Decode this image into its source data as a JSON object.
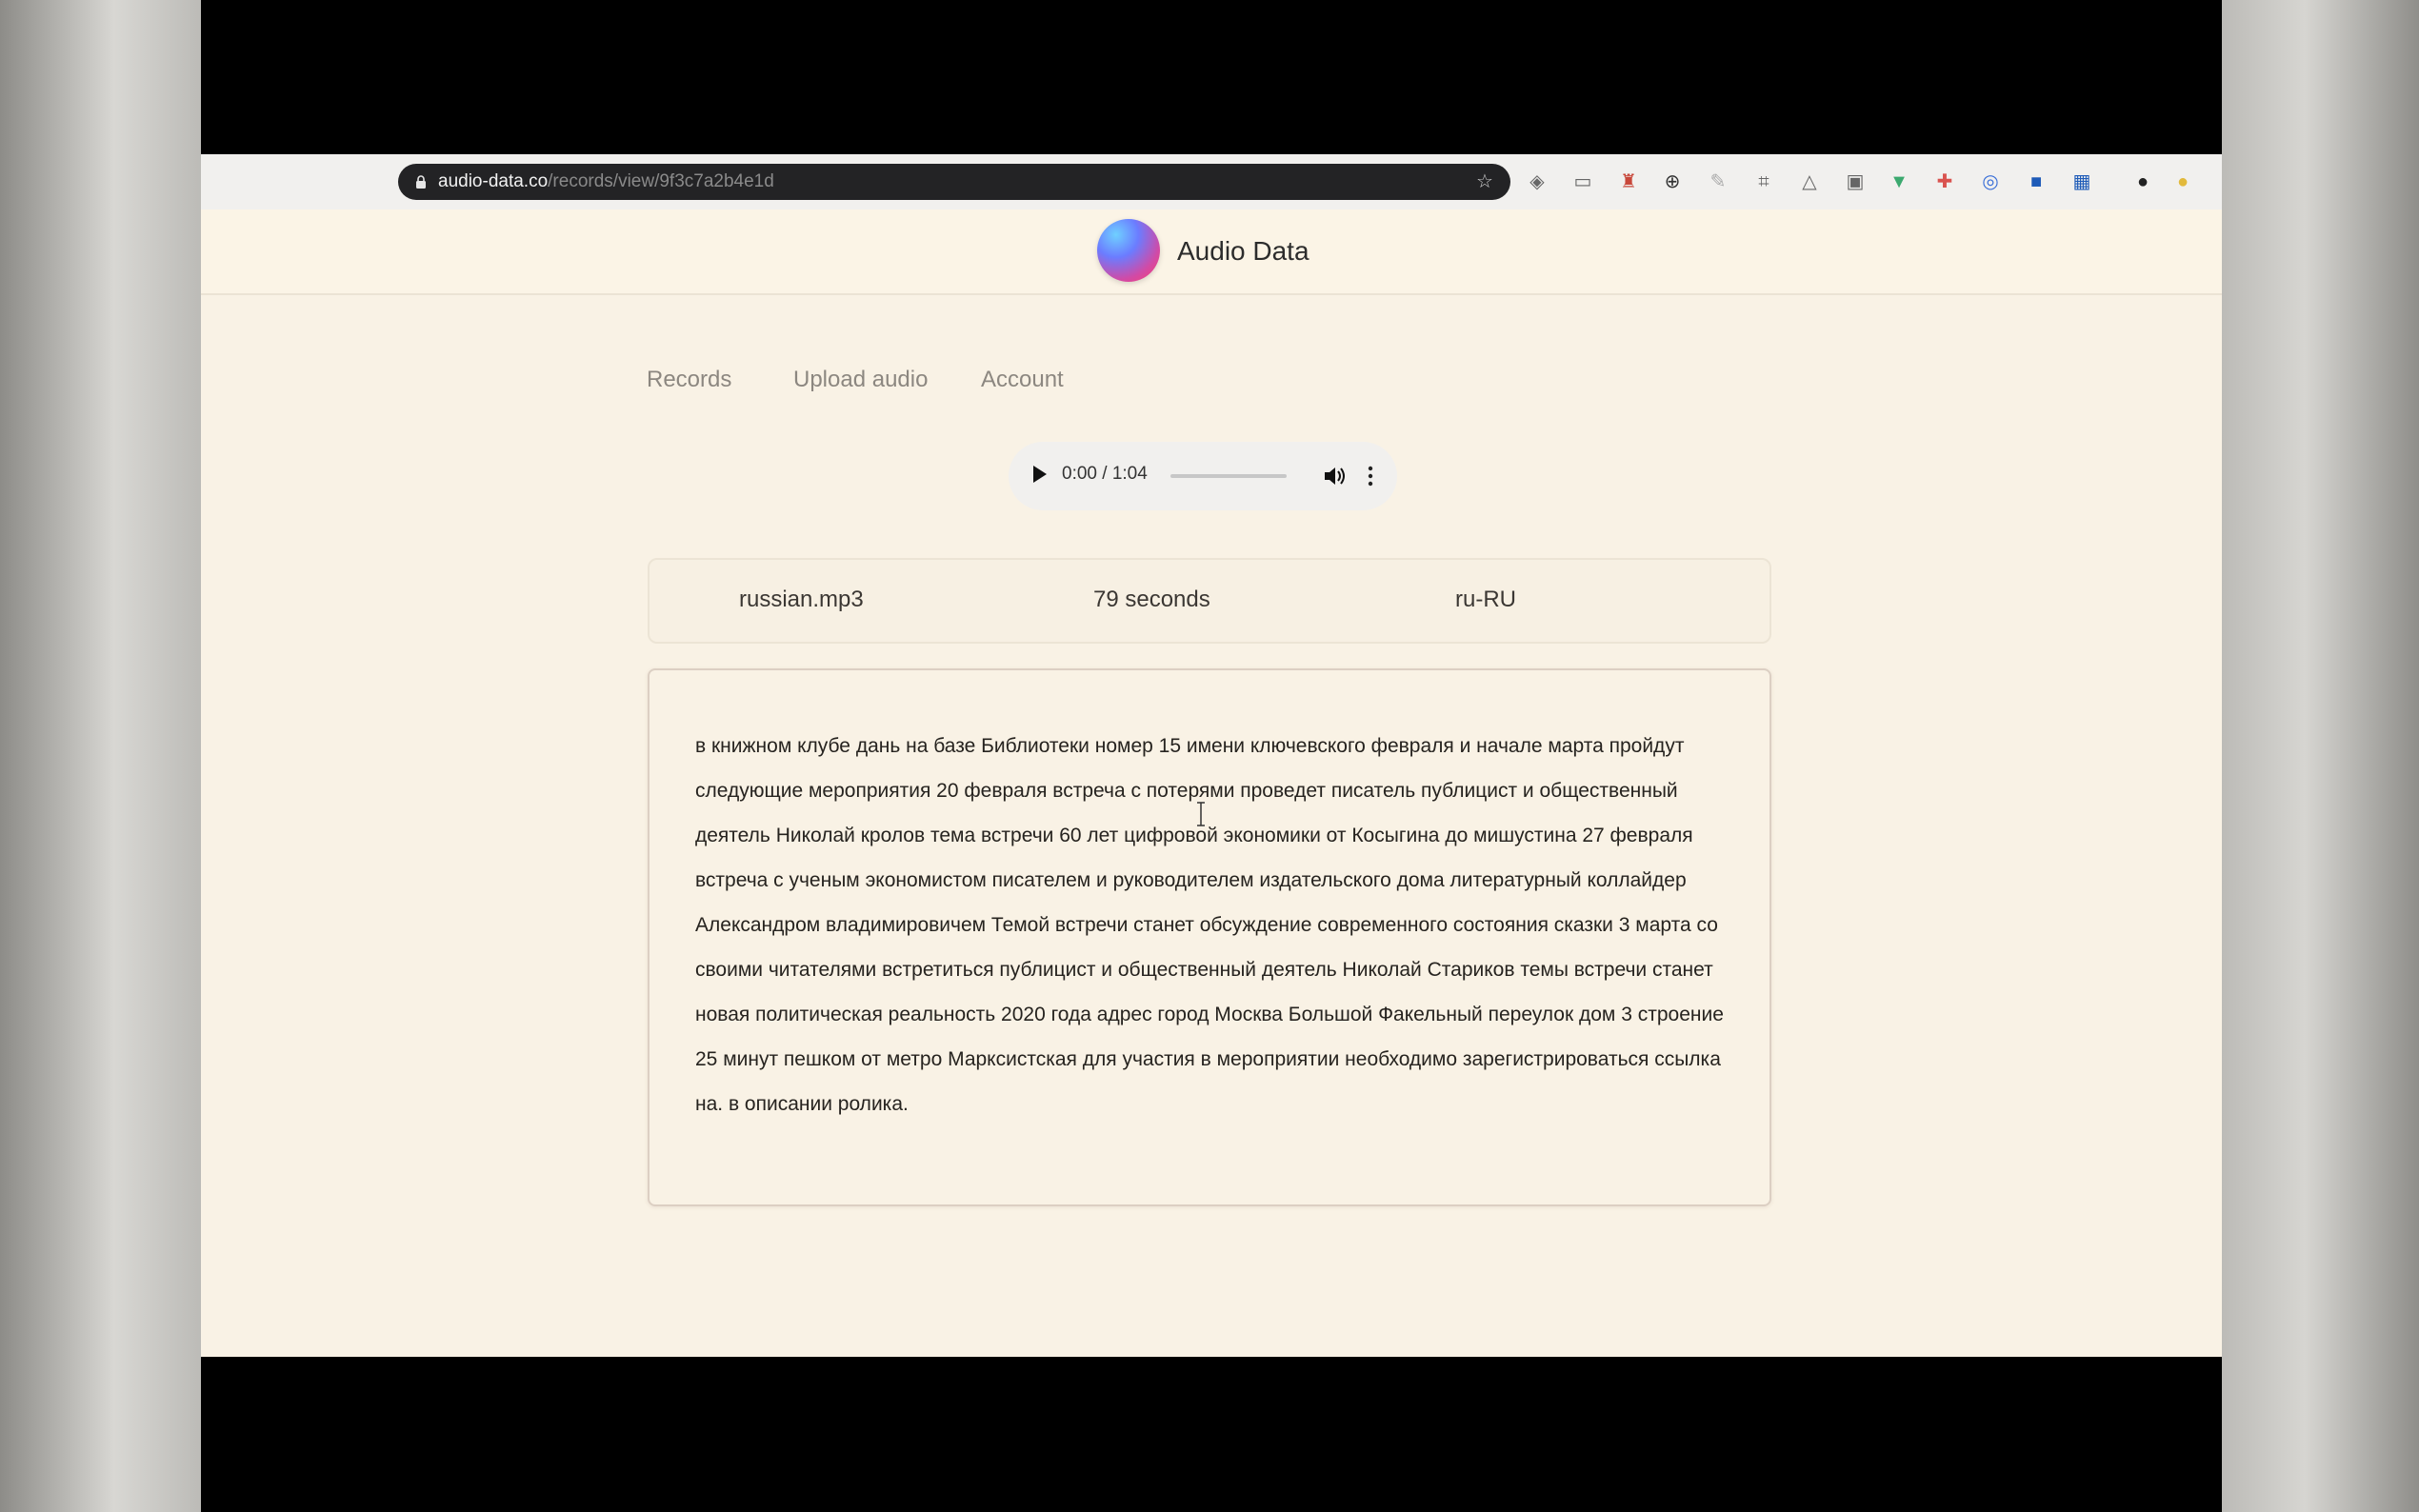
{
  "browser": {
    "url_host": "audio-data.co",
    "url_path": "/records/view/9f3c7a2b4e1d",
    "extensions": [
      "shield-icon",
      "translate-icon",
      "pocket-icon",
      "lock-icon",
      "pen-icon",
      "puzzle-icon",
      "drive-icon",
      "doc-icon",
      "filter-icon",
      "reader-icon",
      "circle-icon",
      "blue-square-icon",
      "blue-square-2-icon",
      "profile-icon",
      "bulb-icon"
    ]
  },
  "site": {
    "brand_name": "Audio Data"
  },
  "nav": {
    "items": [
      {
        "label": "Records"
      },
      {
        "label": "Upload audio"
      },
      {
        "label": "Account"
      }
    ]
  },
  "player": {
    "time": "0:00 / 1:04",
    "progress": 0.0
  },
  "record": {
    "filename": "russian.mp3",
    "duration": "79 seconds",
    "language": "ru-RU"
  },
  "transcript": {
    "text": "в книжном клубе дань на базе Библиотеки номер 15 имени ключевского февраля и начале марта пройдут следующие мероприятия 20 февраля встреча с потерями проведет писатель публицист и общественный деятель Николай кролов тема встречи 60 лет цифровой экономики от Косыгина до мишустина 27 февраля встреча с ученым экономистом писателем и руководителем издательского дома литературный коллайдер Александром владимировичем Темой встречи станет обсуждение современного состояния сказки 3 марта со своими читателями встретиться публицист и общественный деятель Николай Стариков темы встречи станет новая политическая реальность 2020 года адрес город Москва Большой Факельный переулок дом 3 строение 25 минут пешком от метро Марксистская для участия в мероприятии необходимо зарегистрироваться ссылка на. в описании ролика."
  },
  "colors": {
    "page_bg": "#f9f2e5",
    "address_bar": "#232325",
    "nav_text": "#8c8780"
  }
}
